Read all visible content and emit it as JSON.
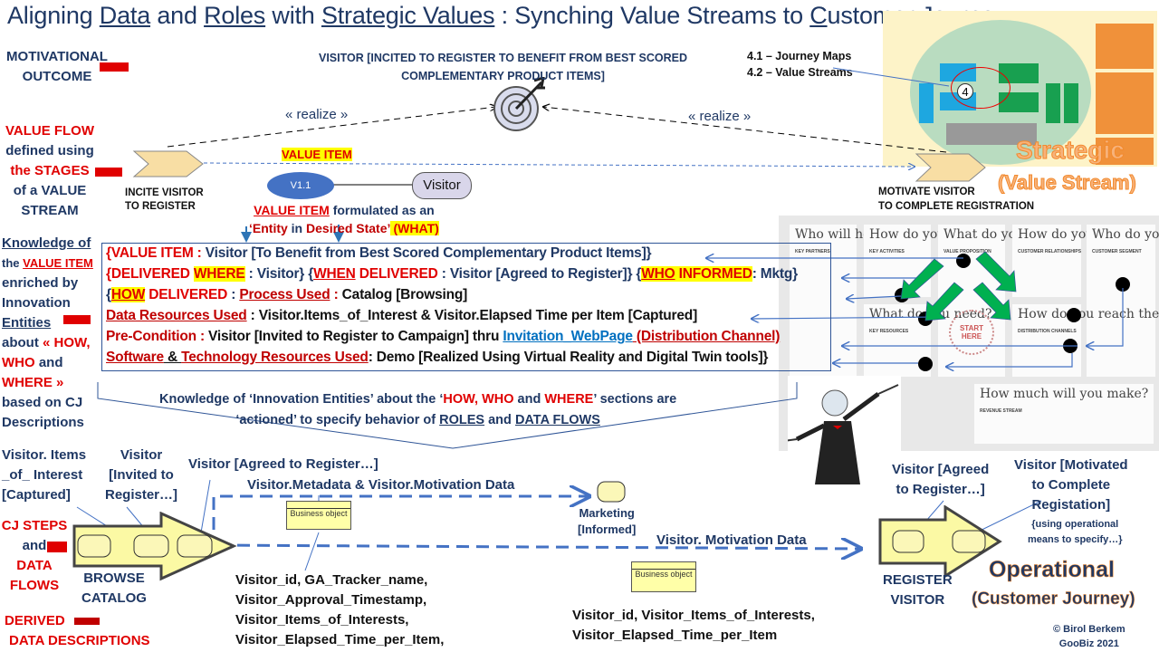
{
  "title": {
    "p1": "Aligning ",
    "p2": "Data",
    "p3": " and ",
    "p4": "Roles",
    "p5": " with ",
    "p6": "Strategic Values",
    "p7": " : Synching Value Streams to ",
    "p8": "C",
    "p9": "ustomer Journey"
  },
  "left": {
    "motivational": "MOTIVATIONAL OUTCOME",
    "value_flow": [
      "VALUE FLOW",
      "defined using",
      "the STAGES",
      "of a VALUE",
      "STREAM"
    ],
    "knowledge": [
      "Knowledge of",
      "the ",
      "VALUE ITEM",
      "enriched  by",
      "Innovation",
      "Entities",
      "about ",
      "« HOW,",
      "WHO",
      " and",
      "WHERE »",
      "based on CJ",
      "Descriptions"
    ],
    "cj_steps": [
      "CJ STEPS",
      "and",
      "DATA",
      "FLOWS"
    ],
    "derived": [
      "DERIVED",
      "DATA DESCRIPTIONS"
    ]
  },
  "top": {
    "visitor_goal": [
      "VISITOR [INCITED TO REGISTER TO BENEFIT FROM BEST SCORED",
      "COMPLEMENTARY PRODUCT ITEMS]"
    ],
    "realize_left": "« realize »",
    "realize_right": "« realize »",
    "stage1": [
      "INCITE VISITOR",
      "TO REGISTER"
    ],
    "stage2": [
      "MOTIVATE VISITOR",
      "TO COMPLETE REGISTRATION"
    ],
    "value_item_tag": "VALUE ITEM",
    "v11": "V1.1",
    "visitor": "Visitor",
    "formulated": {
      "a": "VALUE ITEM",
      "b": " formulated as an",
      "c": "‘Entity",
      "d": " in ",
      "e": "Desired State’",
      "f": " (WHAT)"
    },
    "legend": [
      "4.1 – Journey Maps",
      "4.2 – Value Streams"
    ],
    "circle_num": "4",
    "strategic": "Strategic",
    "strategic_sub": "(Value Stream)"
  },
  "value_box": {
    "lines": [
      [
        {
          "t": "{VALUE  ITEM :",
          "c": "rd"
        },
        {
          "t": "    Visitor [To Benefit from Best Scored Complementary Product Items]}",
          "c": "nv"
        }
      ],
      [
        {
          "t": "{DELIVERED ",
          "c": "rd"
        },
        {
          "t": "WHERE",
          "c": "rd hl"
        },
        {
          "t": " : Visitor} {",
          "c": "nv"
        },
        {
          "t": "WHEN",
          "c": "rd u"
        },
        {
          "t": " DELIVERED",
          "c": "rd"
        },
        {
          "t": " : Visitor [Agreed to Register]} {",
          "c": "nv"
        },
        {
          "t": "WHO",
          "c": "rd hl u"
        },
        {
          "t": " INFORMED",
          "c": "rd hl"
        },
        {
          "t": ": Mktg}",
          "c": "nv"
        }
      ],
      [
        {
          "t": "{",
          "c": "nv"
        },
        {
          "t": "HOW",
          "c": "rd hl u"
        },
        {
          "t": " DELIVERED",
          "c": "rd"
        },
        {
          "t": " :  ",
          "c": "nv"
        },
        {
          "t": "Process Used",
          "c": "dr u"
        },
        {
          "t": " : ",
          "c": "dr"
        },
        {
          "t": " Catalog [Browsing]",
          "c": "bk"
        }
      ],
      [
        {
          "t": "Data Resources Used",
          "c": "dr u"
        },
        {
          "t": "  : Visitor.Items_of_Interest & Visitor.Elapsed Time per Item [Captured]",
          "c": "bk"
        }
      ],
      [
        {
          "t": "Pre-Condition : ",
          "c": "dr"
        },
        {
          "t": "Visitor [Invited to Register to Campaign] thru ",
          "c": "bk"
        },
        {
          "t": "Invitation_WebPage",
          "c": "bl u"
        },
        {
          "t": " (Distribution Channel)",
          "c": "dr u"
        }
      ],
      [
        {
          "t": "Software",
          "c": "dr u"
        },
        {
          "t": " & ",
          "c": "bk u"
        },
        {
          "t": "Technology Resources Used",
          "c": "dr u"
        },
        {
          "t": ":  Demo [Realized Using Virtual Reality and Digital Twin tools]}",
          "c": "bk"
        }
      ]
    ]
  },
  "callout": {
    "l1a": "Knowledge of ‘Innovation Entities’ about the ‘",
    "l1b": "HOW, WHO",
    "l1c": " and ",
    "l1d": "WHERE",
    "l1e": "’ sections are",
    "l2a": "‘actioned’ to specify behavior of ",
    "l2b": "ROLES",
    "l2c": " and ",
    "l2d": "DATA FLOWS"
  },
  "canvas": {
    "cells": [
      {
        "q": "Who will help you?",
        "k": "KEY PARTNERS"
      },
      {
        "q": "How do you do it?",
        "k": "KEY ACTIVITIES"
      },
      {
        "q": "What do you do?",
        "k": "VALUE PROPOSITION"
      },
      {
        "q": "How do you interact?",
        "k": "CUSTOMER RELATIONSHIPS"
      },
      {
        "q": "Who do you help?",
        "k": "CUSTOMER SEGMENT"
      },
      {
        "q": "What do you need?",
        "k": "KEY RESOURCES"
      },
      {
        "q": "How do you reach them?",
        "k": "DISTRIBUTION CHANNELS"
      },
      {
        "q": "How much will you make?",
        "k": "REVENUE STREAM"
      }
    ],
    "start": "START HERE"
  },
  "bottom": {
    "items_interest": [
      "Visitor. Items",
      "_of_ Interest",
      "[Captured]"
    ],
    "invited": [
      "Visitor",
      "[Invited to",
      "Register…]"
    ],
    "agreed": "Visitor [Agreed  to Register…]",
    "meta": "Visitor.Metadata & Visitor.Motivation Data",
    "business_object": "Business object",
    "marketing": [
      "Marketing",
      "[Informed]"
    ],
    "motivation": "Visitor. Motivation Data",
    "browse": [
      "BROWSE",
      "CATALOG"
    ],
    "data1": [
      "Visitor_id, GA_Tracker_name,",
      "Visitor_Approval_Timestamp,",
      "Visitor_Items_of_Interests,",
      "Visitor_Elapsed_Time_per_Item,"
    ],
    "data2": [
      "Visitor_id, Visitor_Items_of_Interests,",
      "Visitor_Elapsed_Time_per_Item"
    ],
    "agreed2": [
      "Visitor [Agreed",
      "to Register…]"
    ],
    "motivated": [
      "Visitor [Motivated",
      "to Complete",
      "Registation]"
    ],
    "using": [
      "{using operational",
      "means to specify…}"
    ],
    "register": [
      "REGISTER",
      "VISITOR"
    ],
    "operational": "Operational",
    "operational_sub": "(Customer Journey)",
    "copyright": [
      "© Birol Berkem",
      "GooBiz 2021"
    ]
  },
  "colors": {
    "navy": "#1f3864",
    "red": "#e00000",
    "highlight": "#ffff00",
    "orange": "#f28a2e",
    "arrow_blue": "#4472c4",
    "green": "#00b050"
  }
}
